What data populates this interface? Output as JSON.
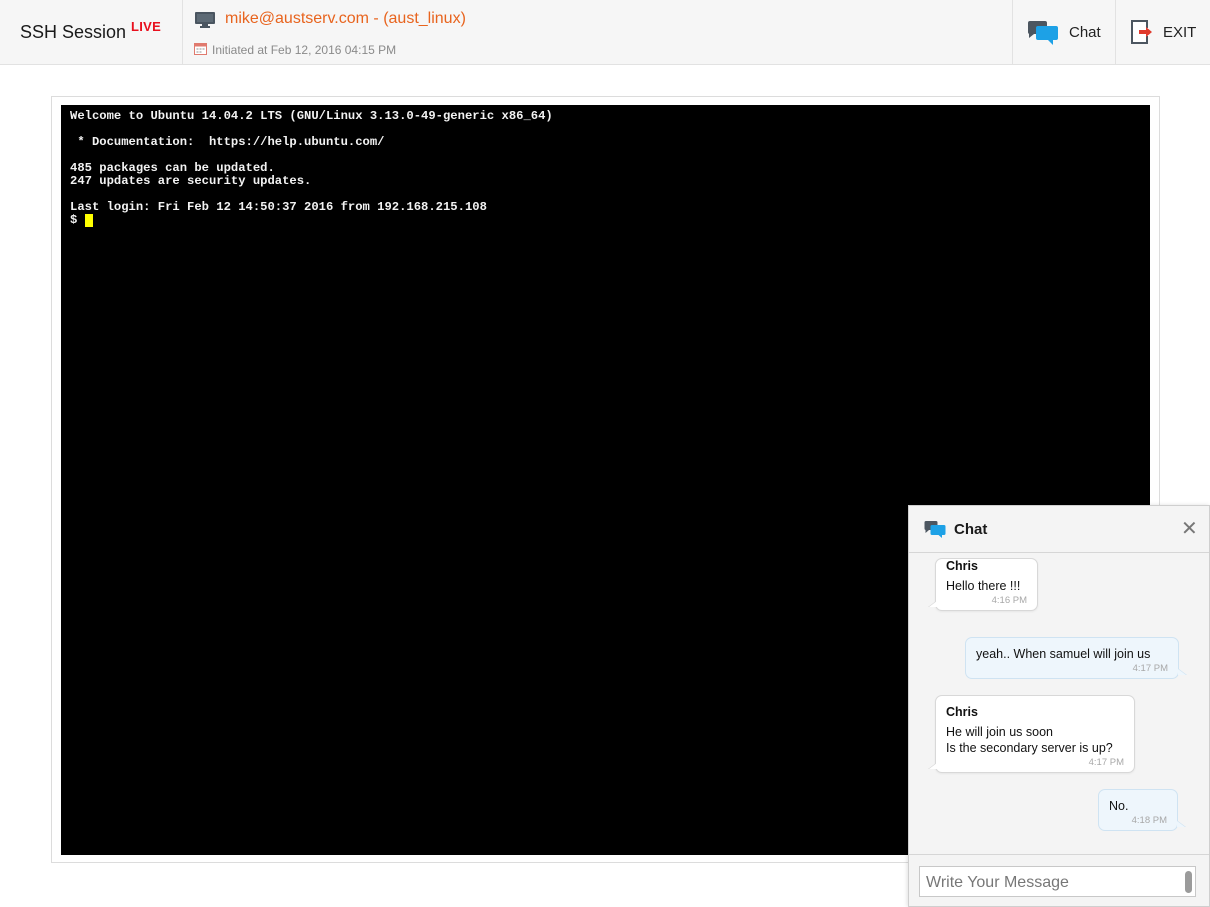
{
  "header": {
    "title": "SSH Session",
    "live_badge": "LIVE",
    "host": "mike@austserv.com - (aust_linux)",
    "initiated": "Initiated at Feb 12, 2016 04:15 PM",
    "chat_label": "Chat",
    "exit_label": "EXIT"
  },
  "terminal": {
    "lines": [
      "Welcome to Ubuntu 14.04.2 LTS (GNU/Linux 3.13.0-49-generic x86_64)",
      "",
      " * Documentation:  https://help.ubuntu.com/",
      "",
      "485 packages can be updated.",
      "247 updates are security updates.",
      "",
      "Last login: Fri Feb 12 14:50:37 2016 from 192.168.215.108"
    ],
    "prompt": "$ "
  },
  "chat": {
    "title": "Chat",
    "messages": [
      {
        "from": "Chris",
        "text": "Hello there !!!",
        "time": "4:16 PM"
      },
      {
        "text": "yeah.. When samuel will join us",
        "time": "4:17 PM"
      },
      {
        "from": "Chris",
        "text_line1": "He will join us soon",
        "text_line2": "Is the secondary server is up?",
        "time": "4:17 PM"
      },
      {
        "text": "No.",
        "time": "4:18 PM"
      }
    ],
    "input_placeholder": "Write Your Message"
  },
  "colors": {
    "live": "#e8101e",
    "host": "#e8641e",
    "chat_icon": "#1da1e6",
    "exit_arrow": "#e03a2c",
    "terminal_bg": "#000000",
    "cursor": "#ffff00"
  }
}
